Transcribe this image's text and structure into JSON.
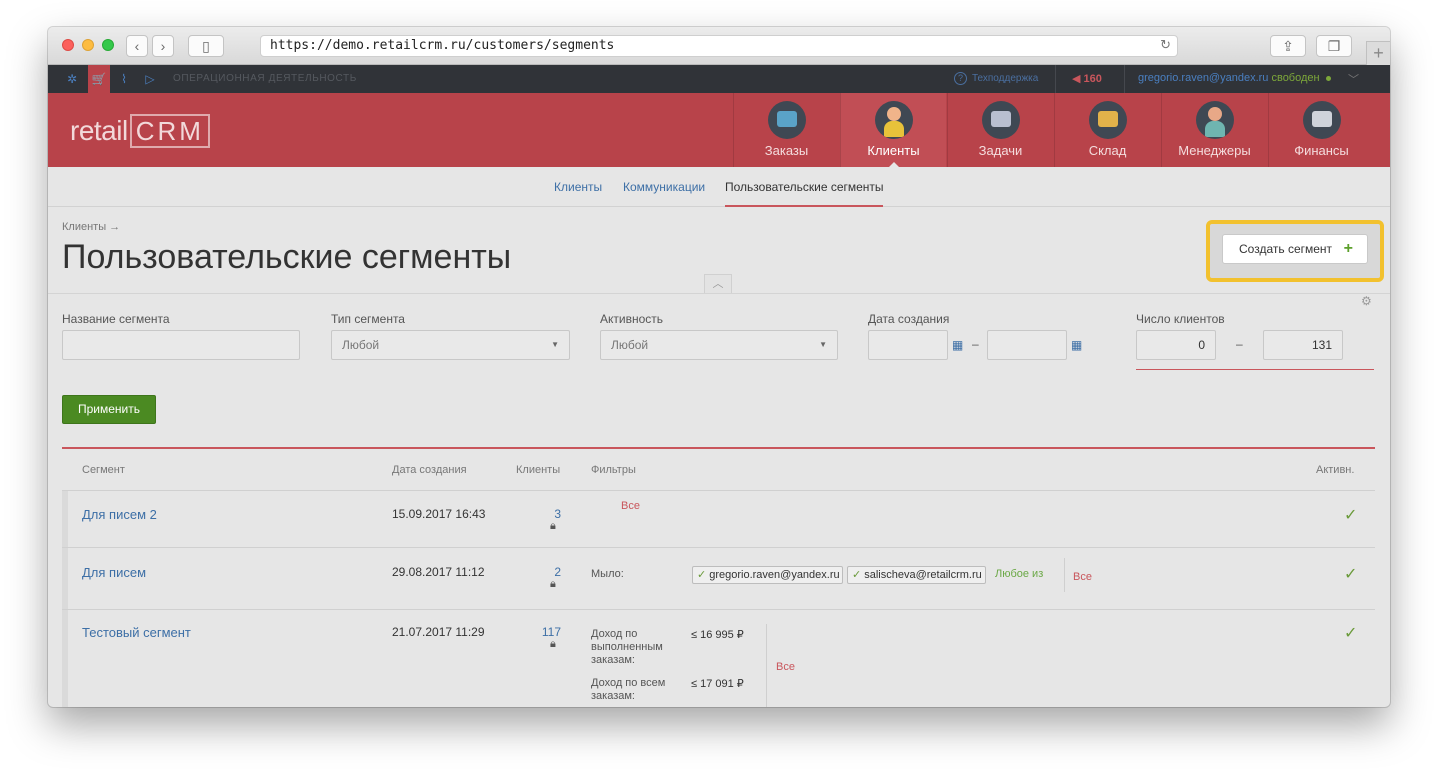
{
  "browser": {
    "url": "https://demo.retailcrm.ru/customers/segments"
  },
  "topbar": {
    "section_label": "ОПЕРАЦИОННАЯ ДЕЯТЕЛЬНОСТЬ",
    "support": "Техподдержка",
    "notifications": "160",
    "user_email": "gregorio.raven@yandex.ru",
    "user_status": "свободен"
  },
  "header": {
    "logo_text": "retail",
    "logo_crm": "CRM",
    "nav": [
      {
        "label": "Заказы",
        "icon": "cart-icon"
      },
      {
        "label": "Клиенты",
        "icon": "customer-icon"
      },
      {
        "label": "Задачи",
        "icon": "tasks-icon"
      },
      {
        "label": "Склад",
        "icon": "warehouse-icon"
      },
      {
        "label": "Менеджеры",
        "icon": "managers-icon"
      },
      {
        "label": "Финансы",
        "icon": "finance-icon"
      }
    ]
  },
  "subnav": {
    "items": [
      "Клиенты",
      "Коммуникации",
      "Пользовательские сегменты"
    ]
  },
  "page": {
    "breadcrumb": "Клиенты →",
    "title": "Пользовательские сегменты",
    "create_button": "Создать сегмент"
  },
  "filters": {
    "name_label": "Название сегмента",
    "name_value": "",
    "type_label": "Тип сегмента",
    "type_value": "Любой",
    "activity_label": "Активность",
    "activity_value": "Любой",
    "date_label": "Дата создания",
    "date_from": "",
    "date_to": "",
    "date_dash": "–",
    "clients_label": "Число клиентов",
    "clients_from": "0",
    "clients_to": "131",
    "clients_dash": "–",
    "apply_button": "Применить"
  },
  "table": {
    "headers": {
      "segment": "Сегмент",
      "created": "Дата создания",
      "clients": "Клиенты",
      "filters": "Фильтры",
      "active": "Активн."
    },
    "rows": [
      {
        "name": "Для писем 2",
        "created": "15.09.2017 16:43",
        "clients": "3",
        "all_label": "Все"
      },
      {
        "name": "Для писем",
        "created": "29.08.2017 11:12",
        "clients": "2",
        "filter_key": "Мыло:",
        "tags": [
          "gregorio.raven@yandex.ru",
          "salischeva@retailcrm.ru"
        ],
        "any_of": "Любое из",
        "all_label": "Все"
      },
      {
        "name": "Тестовый сегмент",
        "created": "21.07.2017 11:29",
        "clients": "117",
        "filter1_key": "Доход по выполненным заказам:",
        "filter1_value": "≤ 16 995 ₽",
        "filter2_key": "Доход по всем заказам:",
        "filter2_value": "≤ 17 091 ₽",
        "all_label": "Все"
      }
    ]
  }
}
